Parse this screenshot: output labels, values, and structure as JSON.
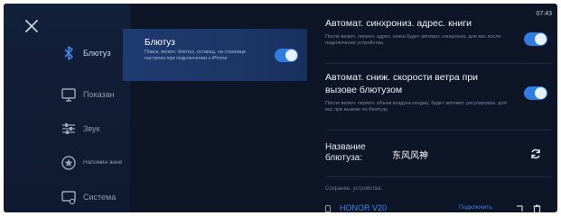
{
  "status": {
    "time": "07:43"
  },
  "nav": {
    "items": [
      {
        "label": "Блютуз",
        "icon": "bluetooth-icon"
      },
      {
        "label": "Показан",
        "icon": "display-icon"
      },
      {
        "label": "Звук",
        "icon": "sliders-icon"
      },
      {
        "label": "Напомин анне",
        "icon": "reminder-icon"
      },
      {
        "label": "Система",
        "icon": "system-icon"
      }
    ]
  },
  "bluetooth_panel": {
    "title": "Блютуз",
    "description": "Поиск, включ. блютуз, остающ. на странице настроек при подключении к iPhone",
    "enabled": true
  },
  "settings": {
    "auto_sync": {
      "title": "Автомат. синхрониз. адрес. книги",
      "description": "После включ. перекл. адрес. книга будет автомат. синхрониз. для вас после подключения устройства.",
      "enabled": true
    },
    "auto_fan": {
      "title_line1": "Автомат. сниж. скорости ветра при",
      "title_line2": "вызове блютузом",
      "description": "После включ. перекл. объем воздуха кондиц. будет автомат. регулирован. для вас при вызове по блютузу.",
      "enabled": true
    },
    "name": {
      "label_line1": "Название",
      "label_line2": "блютуза:",
      "value": "东风风神"
    }
  },
  "saved_devices": {
    "label": "Сохранен. устройства:",
    "items": [
      {
        "name": "HONOR V20",
        "action": "Подключить"
      }
    ]
  },
  "colors": {
    "accent": "#2f7de1",
    "background": "#0d1526",
    "active_panel": "#1f3a6f"
  }
}
